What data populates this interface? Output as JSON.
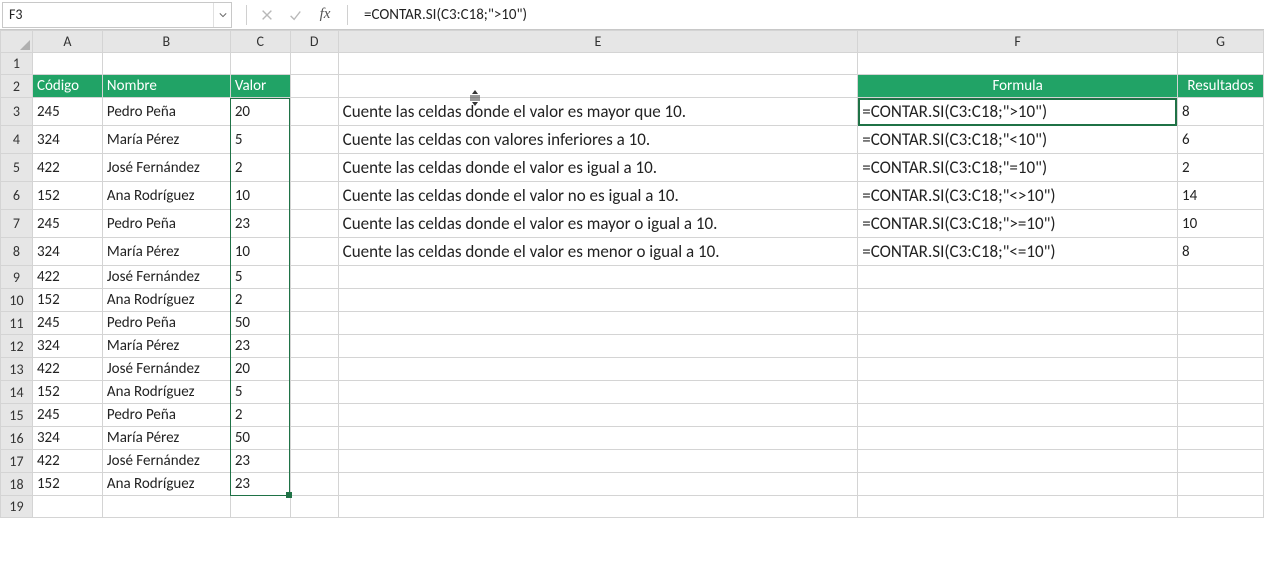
{
  "namebox": {
    "ref": "F3"
  },
  "formula_bar": {
    "fx": "fx",
    "formula": "=CONTAR.SI(C3:C18;\">10\")"
  },
  "columns": [
    "A",
    "B",
    "C",
    "D",
    "E",
    "F",
    "G"
  ],
  "row_numbers": [
    "1",
    "2",
    "3",
    "4",
    "5",
    "6",
    "7",
    "8",
    "9",
    "10",
    "11",
    "12",
    "13",
    "14",
    "15",
    "16",
    "17",
    "18",
    "19"
  ],
  "headers": {
    "A": "Código",
    "B": "Nombre",
    "C": "Valor",
    "F": "Formula",
    "G": "Resultados"
  },
  "table": [
    {
      "codigo": "245",
      "nombre": "Pedro Peña",
      "valor": "20"
    },
    {
      "codigo": "324",
      "nombre": "María Pérez",
      "valor": "5"
    },
    {
      "codigo": "422",
      "nombre": "José Fernández",
      "valor": "2"
    },
    {
      "codigo": "152",
      "nombre": "Ana Rodríguez",
      "valor": "10"
    },
    {
      "codigo": "245",
      "nombre": "Pedro Peña",
      "valor": "23"
    },
    {
      "codigo": "324",
      "nombre": "María Pérez",
      "valor": "10"
    },
    {
      "codigo": "422",
      "nombre": "José Fernández",
      "valor": "5"
    },
    {
      "codigo": "152",
      "nombre": "Ana Rodríguez",
      "valor": "2"
    },
    {
      "codigo": "245",
      "nombre": "Pedro Peña",
      "valor": "50"
    },
    {
      "codigo": "324",
      "nombre": "María Pérez",
      "valor": "23"
    },
    {
      "codigo": "422",
      "nombre": "José Fernández",
      "valor": "20"
    },
    {
      "codigo": "152",
      "nombre": "Ana Rodríguez",
      "valor": "5"
    },
    {
      "codigo": "245",
      "nombre": "Pedro Peña",
      "valor": "2"
    },
    {
      "codigo": "324",
      "nombre": "María Pérez",
      "valor": "50"
    },
    {
      "codigo": "422",
      "nombre": "José Fernández",
      "valor": "23"
    },
    {
      "codigo": "152",
      "nombre": "Ana Rodríguez",
      "valor": "23"
    }
  ],
  "examples": [
    {
      "desc": "Cuente las celdas donde el valor es mayor que 10.",
      "formula": "=CONTAR.SI(C3:C18;\">10\")",
      "result": "8"
    },
    {
      "desc": "Cuente las celdas con valores inferiores a 10.",
      "formula": "=CONTAR.SI(C3:C18;\"<10\")",
      "result": "6"
    },
    {
      "desc": "Cuente las celdas donde el valor es igual a 10.",
      "formula": "=CONTAR.SI(C3:C18;\"=10\")",
      "result": "2"
    },
    {
      "desc": "Cuente las celdas donde el valor no es igual a 10.",
      "formula": "=CONTAR.SI(C3:C18;\"<>10\")",
      "result": "14"
    },
    {
      "desc": "Cuente las celdas donde el valor es mayor o igual a 10.",
      "formula": "=CONTAR.SI(C3:C18;\">=10\")",
      "result": "10"
    },
    {
      "desc": "Cuente las celdas donde el valor es menor o igual a 10.",
      "formula": "=CONTAR.SI(C3:C18;\"<=10\")",
      "result": "8"
    }
  ]
}
